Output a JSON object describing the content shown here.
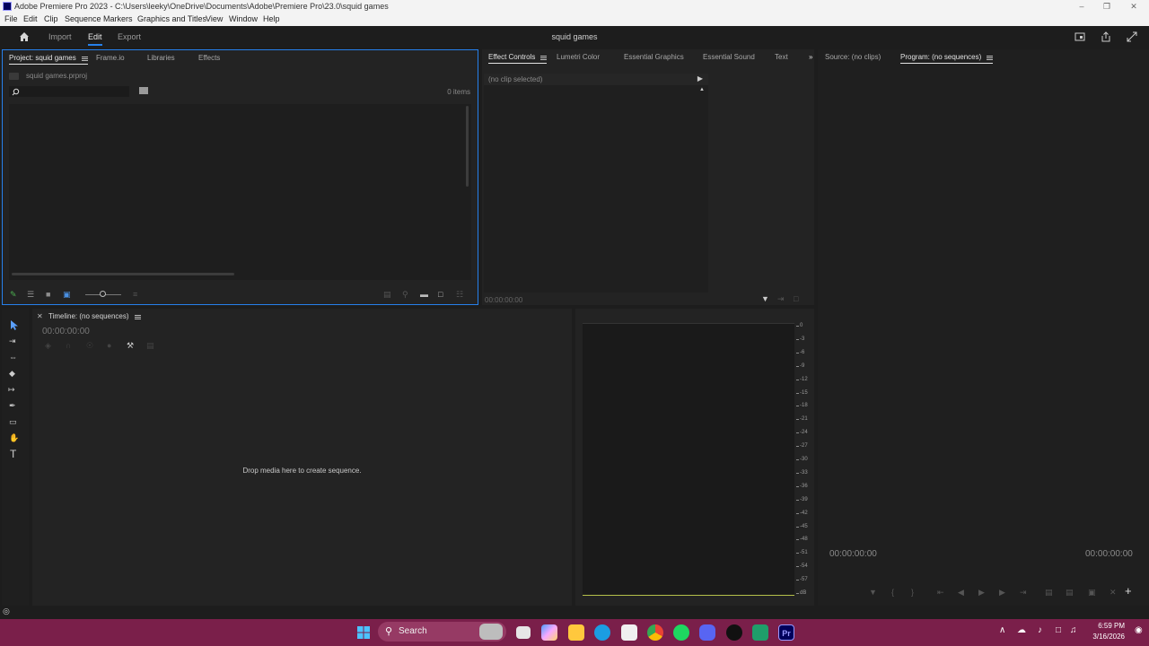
{
  "window": {
    "title": "Adobe Premiere Pro 2023 - C:\\Users\\leeky\\OneDrive\\Documents\\Adobe\\Premiere Pro\\23.0\\squid games",
    "minimize_icon": "minimize-icon",
    "maximize_icon": "restore-icon",
    "close_icon": "close-icon"
  },
  "menu": [
    "File",
    "Edit",
    "Clip",
    "Sequence",
    "Markers",
    "Graphics and Titles",
    "View",
    "Window",
    "Help"
  ],
  "header": {
    "home_icon": "home-icon",
    "workspaces": [
      "Import",
      "Edit",
      "Export"
    ],
    "active_workspace": "Edit",
    "project_name": "squid games"
  },
  "project_panel": {
    "tabs": [
      "Project: squid games",
      "Frame.io",
      "Libraries",
      "Effects"
    ],
    "active_tab": "Project: squid games",
    "file_name": "squid games.prproj",
    "search_placeholder": "",
    "item_count": "0 items"
  },
  "effect_controls": {
    "tabs": [
      "Effect Controls",
      "Lumetri Color",
      "Essential Graphics",
      "Essential Sound",
      "Text"
    ],
    "active_tab": "Effect Controls",
    "no_clip": "(no clip selected)",
    "timecode": "00:00:00:00"
  },
  "monitors": {
    "tabs": [
      "Source: (no clips)",
      "Program: (no sequences)"
    ],
    "active_tab": "Program: (no sequences)",
    "timecode_left": "00:00:00:00",
    "timecode_right": "00:00:00:00"
  },
  "timeline": {
    "title": "Timeline: (no sequences)",
    "timecode": "00:00:00:00",
    "drop_text": "Drop media here to create sequence."
  },
  "audio_meter": {
    "scale": [
      "0",
      "-3",
      "-6",
      "-9",
      "-12",
      "-15",
      "-18",
      "-21",
      "-24",
      "-27",
      "-30",
      "-33",
      "-36",
      "-39",
      "-42",
      "-45",
      "-48",
      "-51",
      "-54",
      "-57",
      "dB"
    ]
  },
  "taskbar": {
    "search_label": "Search",
    "time": "6:59 PM",
    "date": "3/16/2026",
    "apps": [
      "windows-start-icon",
      "task-view-icon",
      "copilot-icon",
      "file-explorer-icon",
      "edge-icon",
      "store-icon",
      "chrome-icon",
      "spotify-icon",
      "discord-icon",
      "capcut-icon",
      "app-icon",
      "premiere-icon"
    ]
  },
  "colors": {
    "accent": "#2680eb",
    "taskbar": "#7a1f4a",
    "panel": "#232323",
    "background": "#1d1d1d"
  }
}
